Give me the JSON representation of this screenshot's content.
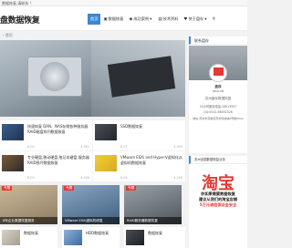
{
  "topbar": {
    "notice": "数据恢复,请联系 !"
  },
  "header": {
    "logo": "盘数据恢复"
  },
  "nav": [
    {
      "label": "首页",
      "icon": ""
    },
    {
      "label": "数据恢复",
      "icon": "▣"
    },
    {
      "label": "成功案例",
      "icon": "◉"
    },
    {
      "label": "技术资料",
      "icon": "▤"
    },
    {
      "label": "关于盘存",
      "icon": "♥"
    }
  ],
  "breadcrumb": "› 首页",
  "cards": [
    {
      "title": "快速恢复 DAN、NAS存储各种服务器RAID磁盘阵列数据恢复",
      "date": "8-03",
      "views": "4,561"
    },
    {
      "title": "SSD数据恢复",
      "date": "8-07",
      "views": "4,340"
    },
    {
      "title": "专业硬盘,移动硬盘,笔记本硬盘,服务器RAID损坏数据恢复",
      "date": "8-03",
      "views": "4,546"
    },
    {
      "title": "VMware ESXi and Hyper-V虚拟化从虚拟机数据恢复",
      "date": "8-04",
      "views": "4,200"
    }
  ],
  "tiles": [
    {
      "tag": "专题",
      "caption": "8年企业数据恢复服务"
    },
    {
      "tag": "专题",
      "caption": "VMware ESXi虚拟机修复"
    },
    {
      "tag": "专题",
      "caption": "RAID服务器数据恢复"
    },
    {
      "tag": "",
      "caption": "数据恢复"
    },
    {
      "tag": "",
      "caption": "HDD数据恢复"
    },
    {
      "tag": "",
      "caption": "数据恢复"
    }
  ],
  "sidebar": {
    "contact_title": "联系盘存",
    "brand": "盘存",
    "brand_en": "PANCUN",
    "company": "苏州盘存数据恢复",
    "hours": "24小时服务电话:18013597",
    "qq": "QQ:0512-68001526",
    "address": "地址:苏州市高新区苏州科技城9号楼0512",
    "ad_title": "苏州全国数据恢复业务",
    "ad_big": "淘宝",
    "ad_line1": "你如果需要数据恢复",
    "ad_line2": "建议从我们的淘宝店铺",
    "ad_line3": "5万元诚信保证金安全"
  },
  "colors": {
    "accent": "#3d87d6",
    "tag_red": "#e53935",
    "ad_red": "#e53935"
  }
}
